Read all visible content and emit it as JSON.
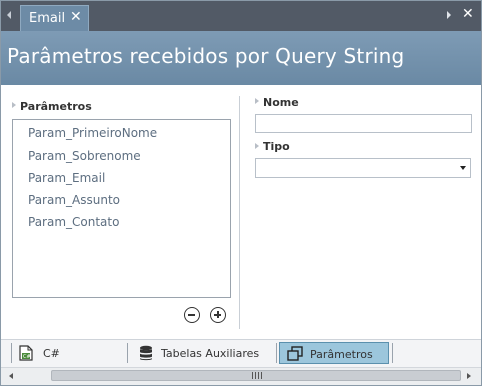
{
  "tab": {
    "label": "Email",
    "close_glyph": "✕"
  },
  "window": {
    "close_glyph": "✕"
  },
  "header": {
    "title": "Parâmetros recebidos por Query String"
  },
  "parameters": {
    "label": "Parâmetros",
    "items": [
      "Param_PrimeiroNome",
      "Param_Sobrenome",
      "Param_Email",
      "Param_Assunto",
      "Param_Contato"
    ]
  },
  "form": {
    "name_label": "Nome",
    "name_value": "",
    "type_label": "Tipo",
    "type_value": ""
  },
  "bottom_tabs": [
    {
      "label": "C#",
      "icon": "csharp-file-icon",
      "active": false
    },
    {
      "label": "Tabelas Auxiliares",
      "icon": "database-icon",
      "active": false
    },
    {
      "label": "Parâmetros",
      "icon": "windows-stack-icon",
      "active": true
    }
  ],
  "colors": {
    "header": "#6d8ba6",
    "tab_strip": "#525a66",
    "active_tab": "#9cc6dc",
    "list_text": "#5d6e80"
  }
}
